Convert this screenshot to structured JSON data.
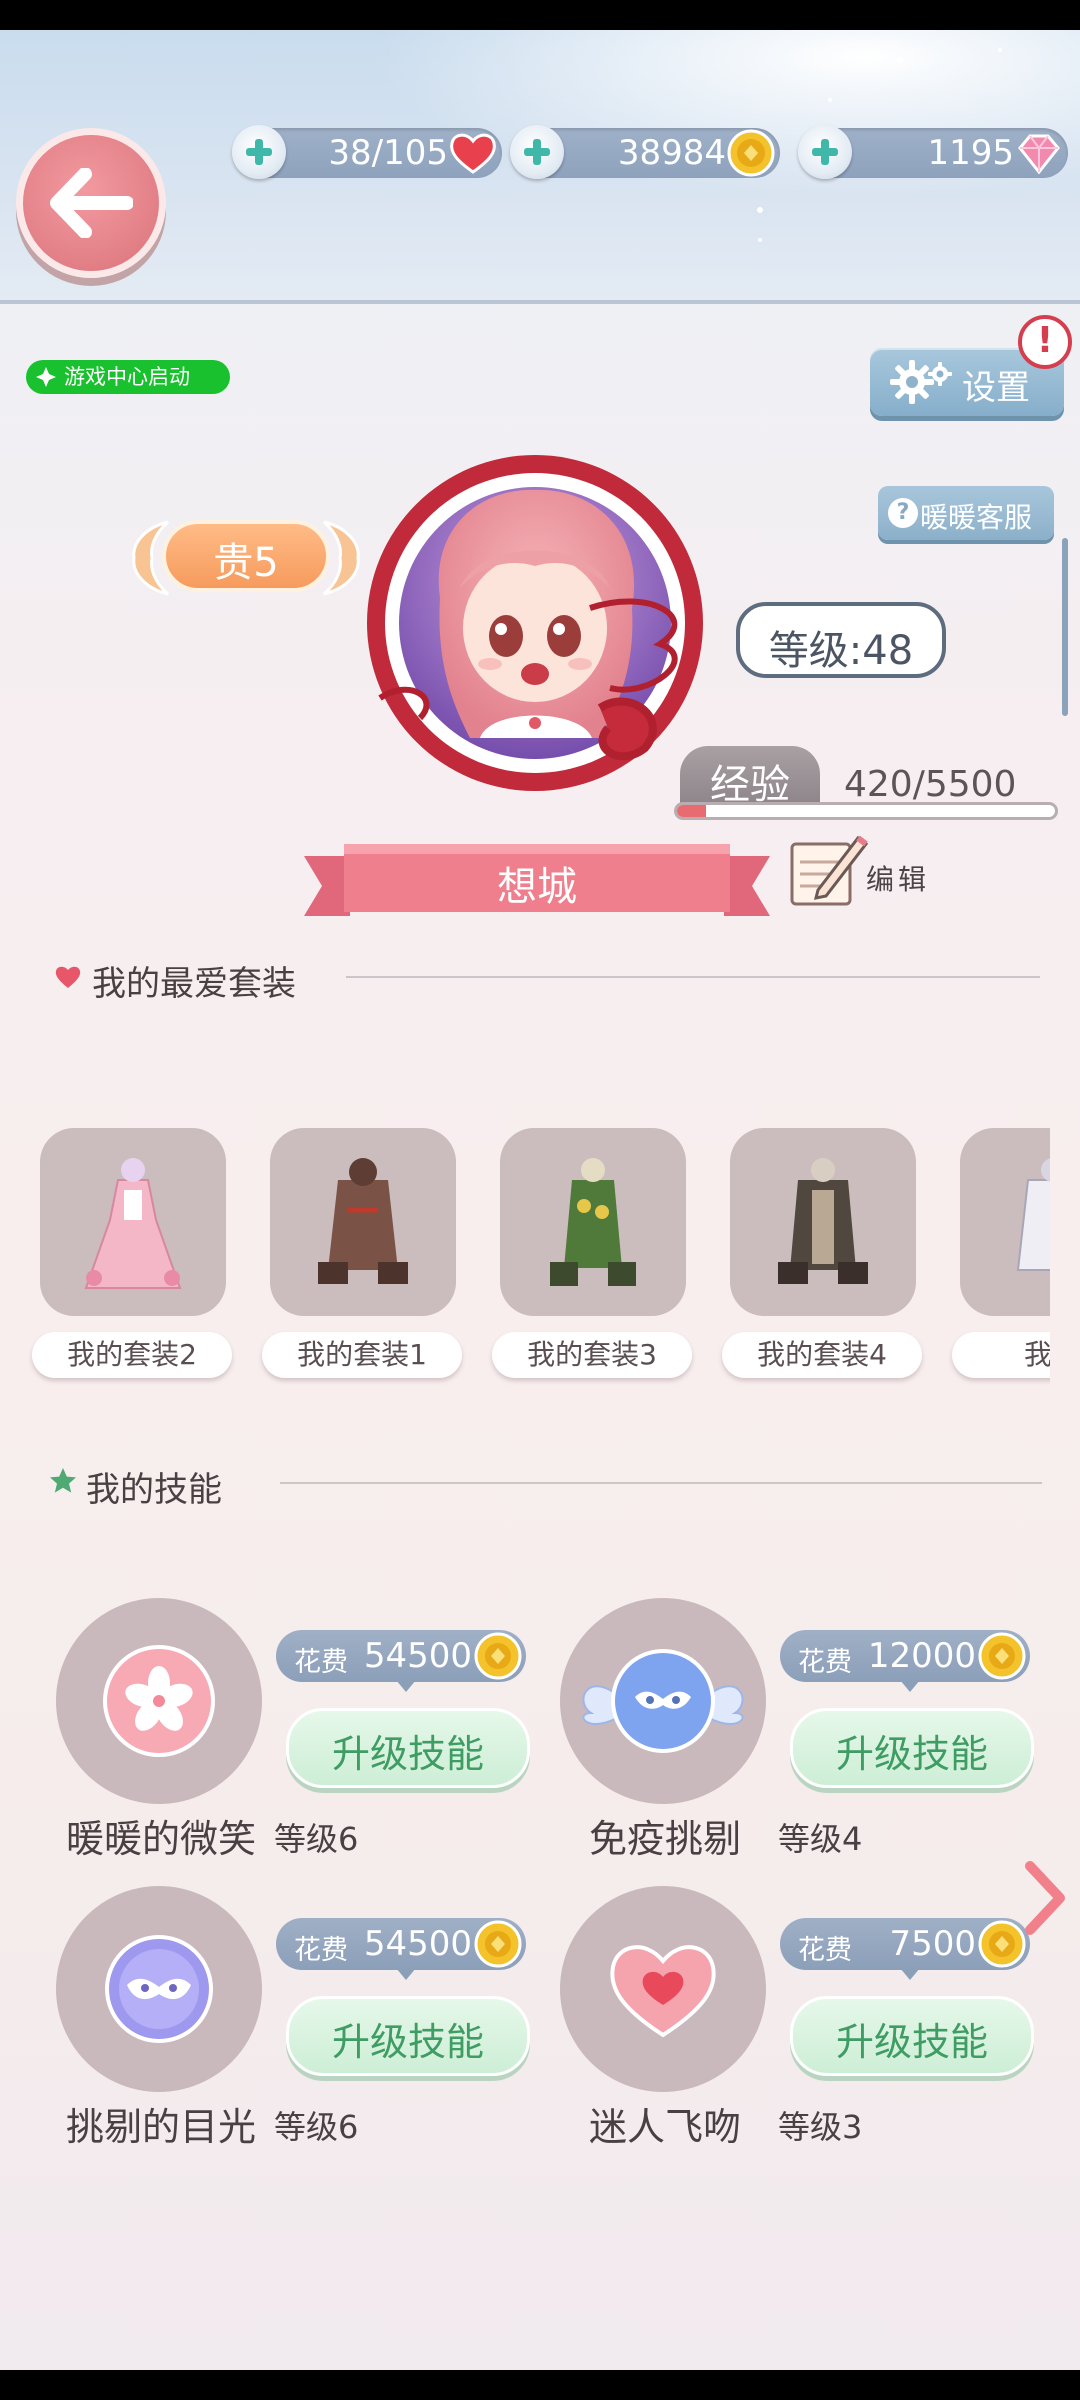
{
  "header": {
    "hearts": "38/105",
    "coins": "38984",
    "diamonds": "1195"
  },
  "game_center": "游戏中心启动",
  "settings_label": "设置",
  "alert_symbol": "!",
  "service_label": "暖暖客服",
  "profile": {
    "vip": "贵5",
    "level": "等级:48",
    "exp_label": "经验",
    "exp_value": "420/5500",
    "exp_fraction": 0.076,
    "name": "想城",
    "edit_label": "编辑"
  },
  "favorites": {
    "title": "我的最爱套装",
    "outfits": [
      {
        "label": "我的套装2"
      },
      {
        "label": "我的套装1"
      },
      {
        "label": "我的套装3"
      },
      {
        "label": "我的套装4"
      },
      {
        "label": "我的"
      }
    ]
  },
  "skills": {
    "title": "我的技能",
    "cost_label": "花费",
    "upgrade_label": "升级技能",
    "items": [
      {
        "name": "暖暖的微笑",
        "level": "等级6",
        "cost": "54500",
        "icon": "sakura-orb-icon"
      },
      {
        "name": "免疫挑剔",
        "level": "等级4",
        "cost": "12000",
        "icon": "winged-mask-orb-icon"
      },
      {
        "name": "挑剔的目光",
        "level": "等级6",
        "cost": "54500",
        "icon": "mask-orb-icon"
      },
      {
        "name": "迷人飞吻",
        "level": "等级3",
        "cost": "7500",
        "icon": "heart-orb-icon"
      }
    ]
  },
  "colors": {
    "accent_pink": "#e27f86",
    "game_center_green": "#18c12d",
    "upgrade_green": "#3f9c63"
  }
}
